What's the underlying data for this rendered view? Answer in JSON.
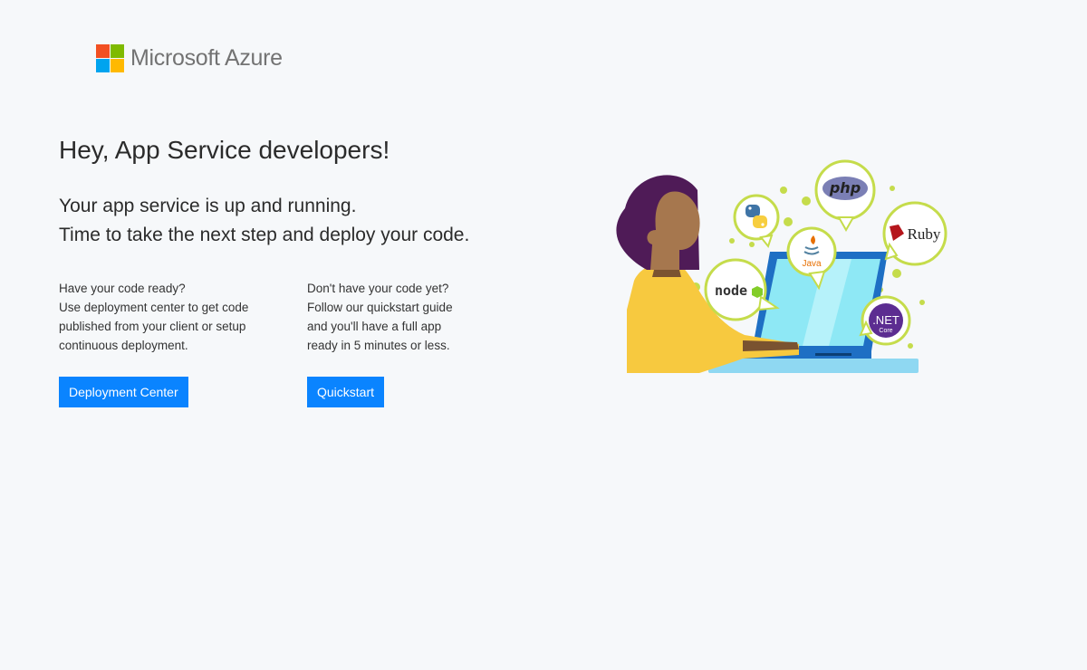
{
  "brand": {
    "name": "Microsoft Azure",
    "logo_colors": [
      "#f25022",
      "#7fba00",
      "#00a4ef",
      "#ffb900"
    ]
  },
  "hero": {
    "title": "Hey, App Service developers!",
    "subtitle_line1": "Your app service is up and running.",
    "subtitle_line2": "Time to take the next step and deploy your code."
  },
  "deploy": {
    "line1": "Have your code ready?",
    "line2": "Use deployment center to get code",
    "line3": "published from your client or setup",
    "line4": "continuous deployment.",
    "button_label": "Deployment Center"
  },
  "quickstart": {
    "line1": "Don't have your code yet?",
    "line2": "Follow our quickstart guide",
    "line3": "and you'll have a full app",
    "line4": "ready in 5 minutes or less.",
    "button_label": "Quickstart"
  },
  "illustration": {
    "php_label": "php",
    "ruby_label": "Ruby",
    "java_label": "Java",
    "node_label": "node",
    "dotnet_label": ".NET",
    "dotnet_sub": "Core"
  },
  "colors": {
    "button": "#0a84ff",
    "bubble_border": "#c5dc4b",
    "screen": "#8ee8f5",
    "laptop": "#1e6fc4",
    "hair": "#4f1b57",
    "skin": "#a6774e",
    "shirt": "#f7c93f"
  }
}
